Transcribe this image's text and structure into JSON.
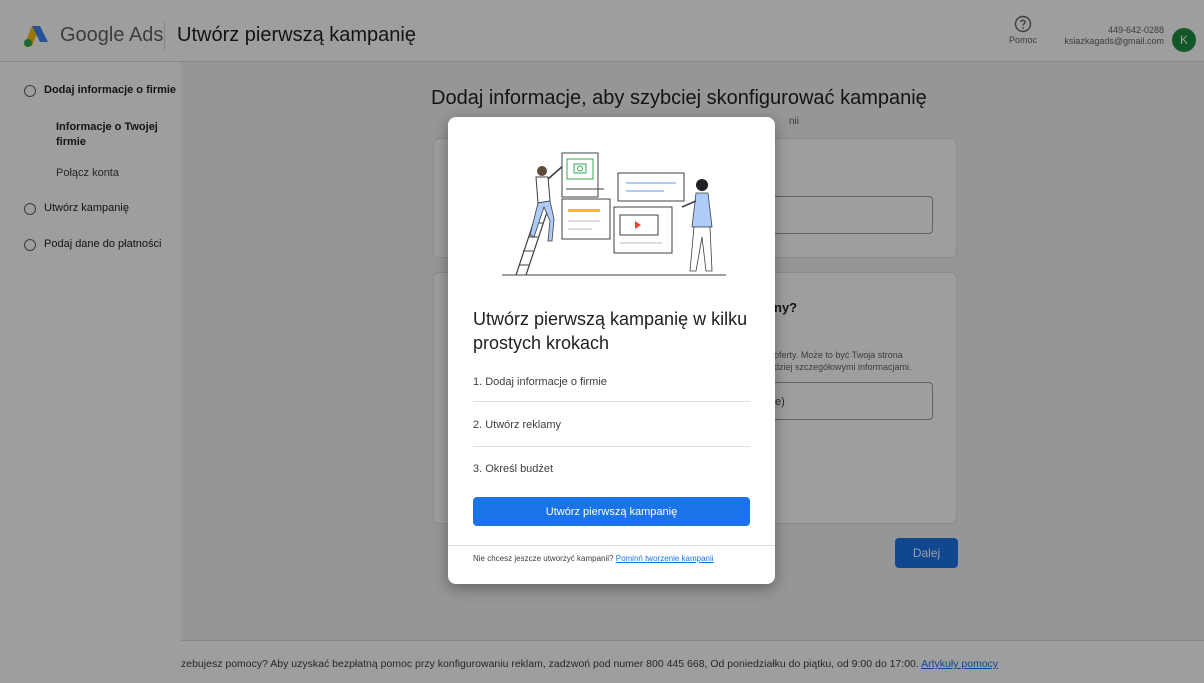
{
  "header": {
    "brand": "Google Ads",
    "page_title": "Utwórz pierwszą kampanię",
    "help_label": "Pomoc",
    "account_id": "449-642-0288",
    "account_email": "ksiazkagads@gmail.com",
    "avatar_initial": "K"
  },
  "sidebar": {
    "steps": [
      {
        "label": "Dodaj informacje o firmie"
      },
      {
        "label": "Utwórz kampanię"
      },
      {
        "label": "Podaj dane do płatności"
      }
    ],
    "substeps": [
      {
        "label": "Informacje o Twojej firmie"
      },
      {
        "label": "Połącz konta"
      }
    ]
  },
  "main": {
    "heading": "Dodaj informacje, aby szybciej skonfigurować kampanię",
    "subtitle": "nii",
    "card2_title": "ny?",
    "card2_desc_line1": "oferty. Może to być Twoja strona",
    "card2_desc_line2": "dziej szczegółowymi informacjami.",
    "input2_value": "e)",
    "next_label": "Dalej"
  },
  "footer": {
    "text": "zebujesz pomocy? Aby uzyskać bezpłatną pomoc przy konfigurowaniu reklam, zadzwoń pod numer 800 445 668, Od poniedziałku do piątku, od 9:00 do 17:00.",
    "link": "Artykuły pomocy"
  },
  "modal": {
    "title": "Utwórz pierwszą kampanię w kilku prostych krokach",
    "steps": [
      "1. Dodaj informacje o firmie",
      "2. Utwórz reklamy",
      "3. Określ budżet"
    ],
    "primary_button": "Utwórz pierwszą kampanię",
    "foot_text": "Nie chcesz jeszcze utworzyć kampanii?",
    "foot_link": "Pominń tworzenie kampanii"
  },
  "colors": {
    "accent": "#1a73e8",
    "avatar": "#1e8e3e"
  }
}
